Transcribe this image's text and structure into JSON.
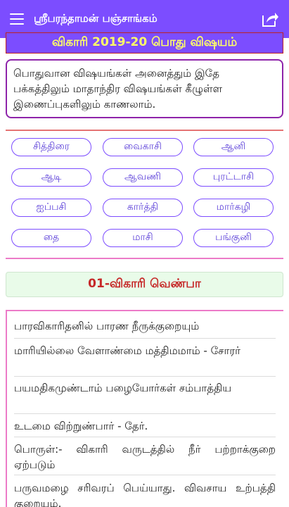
{
  "appbar": {
    "title": "ஸ்ரீபரந்தாமன் பஞ்சாங்கம்",
    "menu_icon": "menu-icon",
    "share_icon": "share-icon"
  },
  "year_heading": "விகாரி 2019-20 பொது விஷயம்",
  "info_text": "பொதுவான விஷயங்கள் அனைத்தும் இதே பக்கத்திலும் மாதாந்திர விஷயங்கள் கீழுள்ள இணைப்புகளிலும் காணலாம்.",
  "months": [
    [
      "சித்திரை",
      "வைகாசி",
      "ஆனி"
    ],
    [
      "ஆடி",
      "ஆவணி",
      "புரட்டாசி"
    ],
    [
      "ஐப்பசி",
      "கார்த்தி",
      "மார்கழி"
    ],
    [
      "தை",
      "மாசி",
      "பங்குனி"
    ]
  ],
  "verse_heading": "01-விகாரி வெண்பா",
  "verses": [
    "பாரவிகாரிதனில் பாரண நீருக்குறையும்",
    "மாரியில்லை வேளாண்மை மத்திமமாம் - சோரர்",
    "பயமதிகமுண்டாம் பழையோர்கள் சம்பாத்திய",
    "உடமை விற்றுண்பார் - தேர்.",
    "பொருள்:- விகாரி வருடத்தில் நீர் பற்றாக்குறை ஏற்படும்",
    "பருவமழை சரிவரப் பெய்யாது. விவசாய உற்பத்தி குறையும்."
  ],
  "colors": {
    "primary": "#7c4dff",
    "year_text": "#ffff66",
    "verse_heading": "#c62828",
    "pink_divider": "#ec7bc8"
  }
}
